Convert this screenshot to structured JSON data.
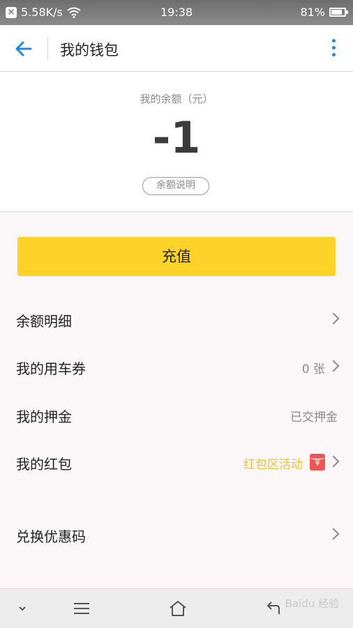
{
  "status_bar": {
    "speed": "5.58K/s",
    "time": "19:38",
    "battery": "81%"
  },
  "header": {
    "title": "我的钱包"
  },
  "balance": {
    "label": "我的余额（元）",
    "value": "-1",
    "explain_button": "余额说明"
  },
  "recharge": {
    "label": "充值"
  },
  "menu": {
    "balance_detail": {
      "label": "余额明细"
    },
    "coupons": {
      "label": "我的用车券",
      "value": "0 张"
    },
    "deposit": {
      "label": "我的押金",
      "value": "已交押金"
    },
    "red_packet": {
      "label": "我的红包",
      "value": "红包区活动"
    },
    "promo_code": {
      "label": "兑换优惠码"
    }
  },
  "watermark": "Baidu 经验",
  "colors": {
    "accent_blue": "#1e88e5",
    "recharge_yellow": "#fdd32a",
    "promo_yellow": "#f0c22a",
    "red_packet": "#f05454"
  }
}
